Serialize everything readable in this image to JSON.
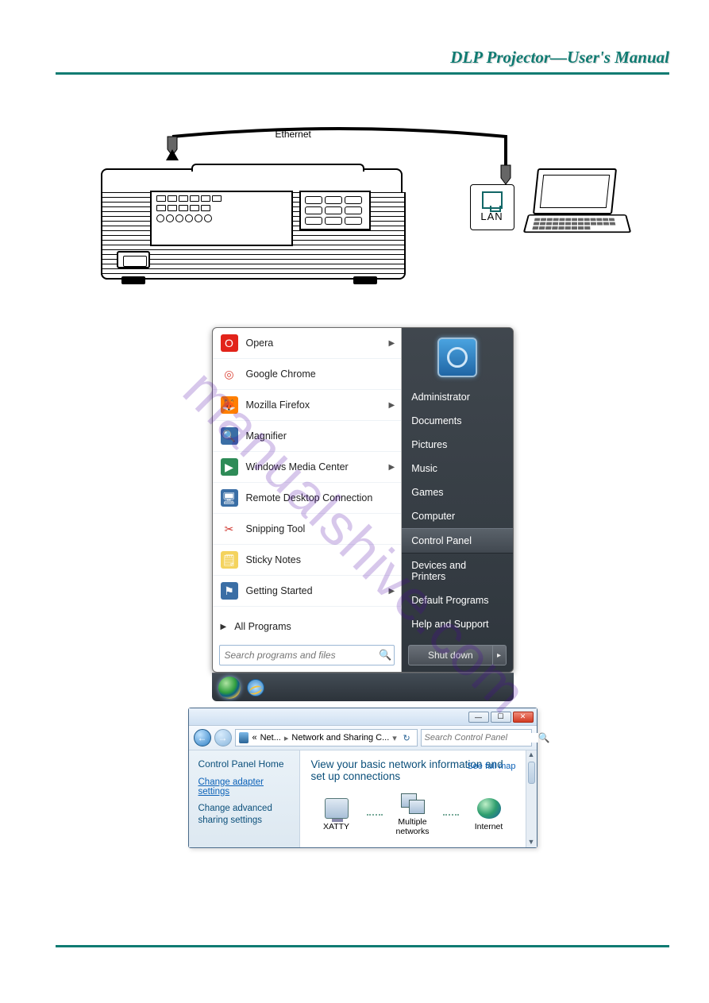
{
  "header": {
    "title": "DLP Projector—User's Manual"
  },
  "section": {
    "title": ""
  },
  "diagram": {
    "ethernet_label": "Ethernet",
    "lan_label": "LAN"
  },
  "watermark": "manualshive.com",
  "start_menu": {
    "left_items": [
      {
        "label": "Opera",
        "icon_bg": "#e2231a",
        "glyph": "O",
        "has_sub": true
      },
      {
        "label": "Google Chrome",
        "icon_bg": "#ffffff",
        "glyph": "◎",
        "has_sub": false,
        "glyph_color": "#db4437"
      },
      {
        "label": "Mozilla Firefox",
        "icon_bg": "#ff7f00",
        "glyph": "🦊",
        "has_sub": true
      },
      {
        "label": "Magnifier",
        "icon_bg": "#3a6ea5",
        "glyph": "🔍",
        "has_sub": false
      },
      {
        "label": "Windows Media Center",
        "icon_bg": "#2e8b57",
        "glyph": "▶",
        "has_sub": true
      },
      {
        "label": "Remote Desktop Connection",
        "icon_bg": "#3a6ea5",
        "glyph": "🖥",
        "has_sub": false
      },
      {
        "label": "Snipping Tool",
        "icon_bg": "#ffffff",
        "glyph": "✂",
        "has_sub": false,
        "glyph_color": "#d0342c"
      },
      {
        "label": "Sticky Notes",
        "icon_bg": "#f4d35e",
        "glyph": "🗒",
        "has_sub": false
      },
      {
        "label": "Getting Started",
        "icon_bg": "#3a6ea5",
        "glyph": "⚑",
        "has_sub": true
      }
    ],
    "all_programs": "All Programs",
    "search_placeholder": "Search programs and files",
    "right_items": [
      {
        "label": "Administrator",
        "active": false
      },
      {
        "label": "Documents",
        "active": false
      },
      {
        "label": "Pictures",
        "active": false
      },
      {
        "label": "Music",
        "active": false
      },
      {
        "label": "Games",
        "active": false
      },
      {
        "label": "Computer",
        "active": false
      },
      {
        "label": "Control Panel",
        "active": true
      },
      {
        "label": "Devices and Printers",
        "active": false
      },
      {
        "label": "Default Programs",
        "active": false
      },
      {
        "label": "Help and Support",
        "active": false
      }
    ],
    "shutdown_label": "Shut down"
  },
  "control_panel": {
    "breadcrumb": {
      "part1": "Net...",
      "part2": "Network and Sharing C..."
    },
    "search_placeholder": "Search Control Panel",
    "side": {
      "home": "Control Panel Home",
      "link_adapter": "Change adapter settings",
      "link_advanced": "Change advanced sharing settings"
    },
    "main": {
      "heading": "View your basic network information and set up connections",
      "full_map": "See full map",
      "nodes": [
        {
          "label": "XATTY",
          "icon": "pc"
        },
        {
          "label": "Multiple networks",
          "icon": "multi"
        },
        {
          "label": "Internet",
          "icon": "globe"
        }
      ]
    }
  }
}
